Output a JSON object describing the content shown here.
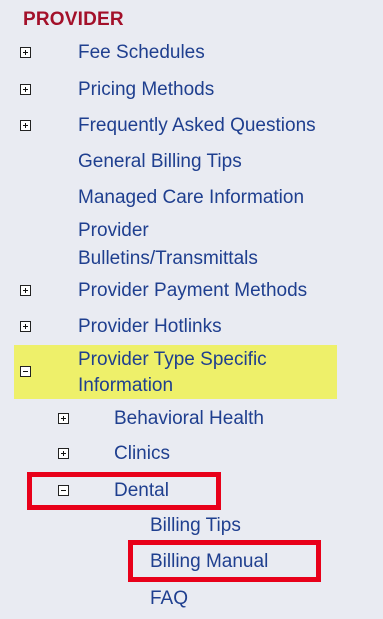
{
  "section": {
    "title": "PROVIDER"
  },
  "menu": {
    "fee_schedules": "Fee Schedules",
    "pricing_methods": "Pricing Methods",
    "faq_top": "Frequently Asked Questions",
    "general_billing_tips": "General Billing Tips",
    "managed_care": "Managed Care Information",
    "bulletins_line1": "Provider",
    "bulletins_line2": "Bulletins/Transmittals",
    "payment_methods": "Provider Payment Methods",
    "hotlinks": "Provider Hotlinks",
    "type_specific_line1": "Provider Type Specific",
    "type_specific_line2": "Information",
    "behavioral_health": "Behavioral Health",
    "clinics": "Clinics",
    "dental": "Dental",
    "billing_tips": "Billing Tips",
    "billing_manual": "Billing Manual",
    "faq": "FAQ"
  },
  "colors": {
    "title": "#a3102a",
    "link": "#1f3f8f",
    "highlight": "#eef06a",
    "annotation": "#e8001a"
  }
}
